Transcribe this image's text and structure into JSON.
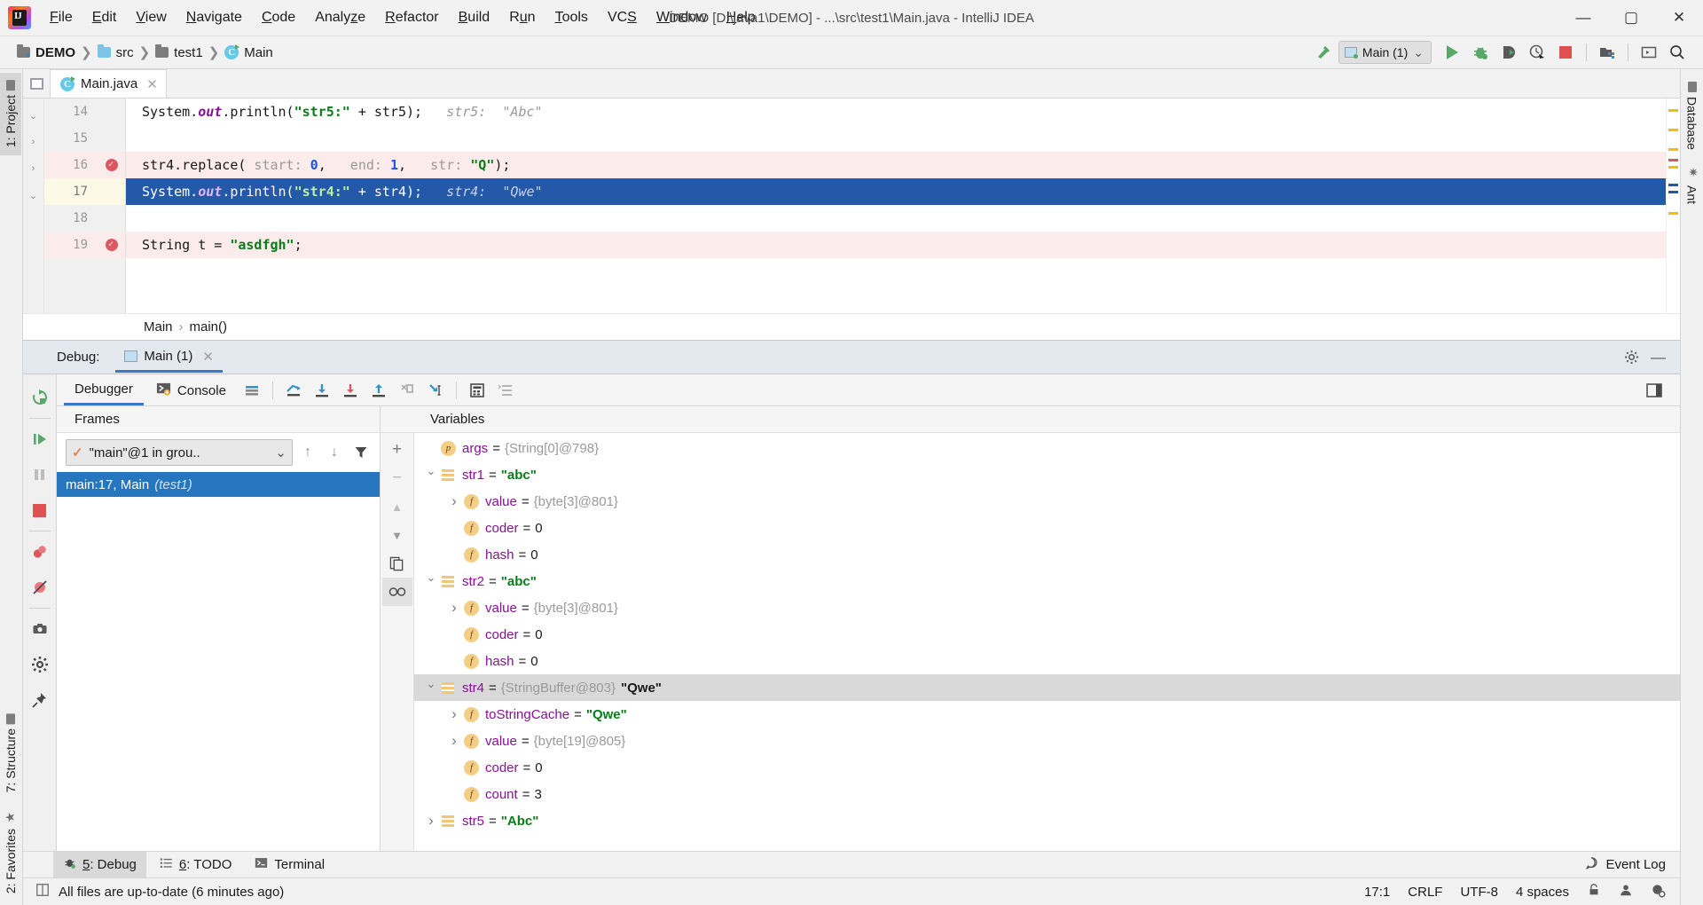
{
  "window": {
    "title": "DEMO [D:\\java1\\DEMO] - ...\\src\\test1\\Main.java - IntelliJ IDEA",
    "minimize": "—",
    "maximize": "▢",
    "close": "✕"
  },
  "menubar": [
    {
      "label": "File"
    },
    {
      "label": "Edit"
    },
    {
      "label": "View"
    },
    {
      "label": "Navigate"
    },
    {
      "label": "Code"
    },
    {
      "label": "Analyze"
    },
    {
      "label": "Refactor"
    },
    {
      "label": "Build"
    },
    {
      "label": "Run"
    },
    {
      "label": "Tools"
    },
    {
      "label": "VCS"
    },
    {
      "label": "Window"
    },
    {
      "label": "Help"
    }
  ],
  "breadcrumbs": [
    {
      "label": "DEMO",
      "icon": "project-folder-icon"
    },
    {
      "label": "src",
      "icon": "source-folder-icon"
    },
    {
      "label": "test1",
      "icon": "package-folder-icon"
    },
    {
      "label": "Main",
      "icon": "java-class-icon"
    }
  ],
  "toolbar": {
    "run_config": "Main (1)",
    "run_config_chevron": "⌄",
    "icons": [
      {
        "name": "build-hammer-icon"
      },
      {
        "name": "run-icon"
      },
      {
        "name": "debug-icon"
      },
      {
        "name": "run-with-coverage-icon"
      },
      {
        "name": "profiler-icon"
      },
      {
        "name": "stop-icon"
      },
      {
        "name": "project-structure-icon"
      },
      {
        "name": "terminal-icon"
      },
      {
        "name": "search-everywhere-icon"
      }
    ]
  },
  "left_tool_strip": [
    {
      "label": "1: Project",
      "selected": true
    },
    {
      "label": "7: Structure",
      "selected": false
    },
    {
      "label": "2: Favorites",
      "selected": false
    }
  ],
  "right_tool_strip": [
    {
      "label": "Database"
    },
    {
      "label": "Ant"
    }
  ],
  "editor": {
    "tab": {
      "label": "Main.java",
      "close": "✕"
    },
    "breadcrumb": [
      "Main",
      "main()"
    ],
    "breadcrumb_sep": "›",
    "lines": [
      {
        "number": "14",
        "breakpoint": false,
        "state": "normal",
        "tokens": [
          {
            "t": "System.",
            "c": "plain"
          },
          {
            "t": "out",
            "c": "field"
          },
          {
            "t": ".println(",
            "c": "plain"
          },
          {
            "t": "\"str5:\"",
            "c": "str"
          },
          {
            "t": " + str5);",
            "c": "plain"
          },
          {
            "t": "   str5:  \"Abc\"",
            "c": "hint"
          }
        ]
      },
      {
        "number": "15",
        "breakpoint": false,
        "state": "normal",
        "tokens": []
      },
      {
        "number": "16",
        "breakpoint": true,
        "state": "breakpoint-line",
        "tokens": [
          {
            "t": "str4.replace(",
            "c": "plain"
          },
          {
            "t": " start: ",
            "c": "phint"
          },
          {
            "t": "0",
            "c": "num"
          },
          {
            "t": ",   ",
            "c": "plain"
          },
          {
            "t": "end: ",
            "c": "phint"
          },
          {
            "t": "1",
            "c": "num"
          },
          {
            "t": ",   ",
            "c": "plain"
          },
          {
            "t": "str: ",
            "c": "phint"
          },
          {
            "t": "\"Q\"",
            "c": "str"
          },
          {
            "t": ");",
            "c": "plain"
          }
        ]
      },
      {
        "number": "17",
        "breakpoint": false,
        "state": "current-execution",
        "tokens": [
          {
            "t": "System.",
            "c": "plain"
          },
          {
            "t": "out",
            "c": "field"
          },
          {
            "t": ".println(",
            "c": "plain"
          },
          {
            "t": "\"str4:\"",
            "c": "str"
          },
          {
            "t": " + str4);",
            "c": "plain"
          },
          {
            "t": "   str4:  \"Qwe\"",
            "c": "hint"
          }
        ]
      },
      {
        "number": "18",
        "breakpoint": false,
        "state": "normal",
        "tokens": []
      },
      {
        "number": "19",
        "breakpoint": true,
        "state": "breakpoint-line",
        "tokens": [
          {
            "t": "String t = ",
            "c": "plain"
          },
          {
            "t": "\"asdfgh\"",
            "c": "str"
          },
          {
            "t": ";",
            "c": "plain"
          }
        ]
      }
    ]
  },
  "debug": {
    "label": "Debug:",
    "session_tab": "Main (1)",
    "session_close": "✕",
    "settings_icon": "gear-icon",
    "hide_icon": "minimize-icon",
    "tabs": [
      {
        "label": "Debugger",
        "selected": true,
        "icon": null
      },
      {
        "label": "Console",
        "selected": false,
        "icon": "console-icon"
      }
    ],
    "toolbar_icons": [
      {
        "name": "layout-settings-icon"
      },
      {
        "name": "show-execution-point-icon"
      },
      {
        "name": "step-over-icon"
      },
      {
        "name": "step-into-icon"
      },
      {
        "name": "step-out-icon"
      },
      {
        "name": "force-step-into-icon"
      },
      {
        "name": "run-to-cursor-icon"
      },
      {
        "name": "evaluate-expression-icon"
      },
      {
        "name": "watches-icon"
      }
    ],
    "side_actions": [
      {
        "name": "rerun-icon"
      },
      {
        "name": "resume-program-icon"
      },
      {
        "name": "pause-program-icon"
      },
      {
        "name": "stop-icon"
      },
      {
        "name": "view-breakpoints-icon"
      },
      {
        "name": "mute-breakpoints-icon"
      },
      {
        "name": "get-thread-dump-icon"
      },
      {
        "name": "settings-icon"
      },
      {
        "name": "pin-tab-icon"
      }
    ],
    "frames": {
      "title": "Frames",
      "thread": "\"main\"@1 in grou..",
      "thread_chevron": "⌄",
      "thread_check": "✓",
      "up_arrow": "↑",
      "down_arrow": "↓",
      "filter_icon": "filter-icon",
      "rows": [
        {
          "text": "main:17, Main",
          "italic": "(test1)",
          "selected": true
        }
      ]
    },
    "variables": {
      "title": "Variables",
      "tool_buttons": [
        "+",
        "−",
        "▲",
        "▼",
        "copy-icon",
        "inspect-icon"
      ],
      "rows": [
        {
          "indent": 1,
          "chev": "none",
          "icon": "p",
          "name": "args",
          "eq": "=",
          "value": "{String[0]@798}",
          "vtype": "ref",
          "selected": false
        },
        {
          "indent": 1,
          "chev": "open",
          "icon": "obj",
          "name": "str1",
          "eq": "=",
          "value": "\"abc\"",
          "vtype": "str",
          "selected": false
        },
        {
          "indent": 2,
          "chev": "closed",
          "icon": "f",
          "name": "value",
          "eq": "=",
          "value": "{byte[3]@801}",
          "vtype": "ref",
          "selected": false
        },
        {
          "indent": 2,
          "chev": "none",
          "icon": "f",
          "name": "coder",
          "eq": "=",
          "value": "0",
          "vtype": "num",
          "selected": false
        },
        {
          "indent": 2,
          "chev": "none",
          "icon": "f",
          "name": "hash",
          "eq": "=",
          "value": "0",
          "vtype": "num",
          "selected": false
        },
        {
          "indent": 1,
          "chev": "open",
          "icon": "obj",
          "name": "str2",
          "eq": "=",
          "value": "\"abc\"",
          "vtype": "str",
          "selected": false
        },
        {
          "indent": 2,
          "chev": "closed",
          "icon": "f",
          "name": "value",
          "eq": "=",
          "value": "{byte[3]@801}",
          "vtype": "ref",
          "selected": false
        },
        {
          "indent": 2,
          "chev": "none",
          "icon": "f",
          "name": "coder",
          "eq": "=",
          "value": "0",
          "vtype": "num",
          "selected": false
        },
        {
          "indent": 2,
          "chev": "none",
          "icon": "f",
          "name": "hash",
          "eq": "=",
          "value": "0",
          "vtype": "num",
          "selected": false
        },
        {
          "indent": 1,
          "chev": "open",
          "icon": "obj",
          "name": "str4",
          "eq": "=",
          "value": "{StringBuffer@803}",
          "value2": "\"Qwe\"",
          "vtype": "ref",
          "selected": true
        },
        {
          "indent": 2,
          "chev": "closed",
          "icon": "f",
          "name": "toStringCache",
          "eq": "=",
          "value": "\"Qwe\"",
          "vtype": "str",
          "selected": false
        },
        {
          "indent": 2,
          "chev": "closed",
          "icon": "f",
          "name": "value",
          "eq": "=",
          "value": "{byte[19]@805}",
          "vtype": "ref",
          "selected": false
        },
        {
          "indent": 2,
          "chev": "none",
          "icon": "f",
          "name": "coder",
          "eq": "=",
          "value": "0",
          "vtype": "num",
          "selected": false
        },
        {
          "indent": 2,
          "chev": "none",
          "icon": "f",
          "name": "count",
          "eq": "=",
          "value": "3",
          "vtype": "num",
          "selected": false
        },
        {
          "indent": 1,
          "chev": "closed",
          "icon": "obj",
          "name": "str5",
          "eq": "=",
          "value": "\"Abc\"",
          "vtype": "str",
          "selected": false
        }
      ]
    }
  },
  "toolwindow_bar": {
    "items": [
      {
        "label": "5: Debug",
        "icon": "debug-icon",
        "selected": true
      },
      {
        "label": "6: TODO",
        "icon": "todo-icon",
        "selected": false
      },
      {
        "label": "Terminal",
        "icon": "terminal-icon",
        "selected": false
      }
    ],
    "event_log": "Event Log",
    "event_log_icon": "balloon-icon"
  },
  "statusbar": {
    "message": "All files are up-to-date (6 minutes ago)",
    "message_icon": "file-sync-icon",
    "caret": "17:1",
    "line_sep": "CRLF",
    "encoding": "UTF-8",
    "indent": "4 spaces",
    "right_icons": [
      "lock-icon",
      "user-icon",
      "inspections-icon"
    ]
  },
  "colors": {
    "accent_blue": "#2458a8",
    "selection_blue": "#2675bf",
    "tab_underline": "#3c76c8",
    "breakpoint_red": "#db5860",
    "string_green": "#067d17",
    "field_purple": "#871094",
    "number_blue": "#1750eb",
    "warn_line_bg": "#fbeceb",
    "current_line_gutter": "#fcfae6"
  }
}
